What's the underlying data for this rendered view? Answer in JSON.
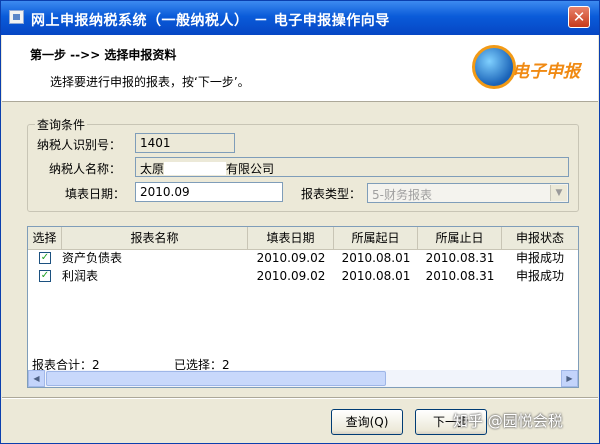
{
  "window": {
    "title": "网上申报纳税系统（一般纳税人） － 电子申报操作向导",
    "close_glyph": "✕"
  },
  "header": {
    "step_title": "第一步 -->> 选择申报资料",
    "step_desc": "选择要进行申报的报表，按‘下一步’。",
    "logo_text": "电子申报"
  },
  "query": {
    "legend": "查询条件",
    "taxpayer_id_label": "纳税人识别号：",
    "taxpayer_id_value": "1401",
    "taxpayer_name_label": "纳税人名称：",
    "taxpayer_name_value_a": "太原",
    "taxpayer_name_value_b": "有限公司",
    "fill_date_label": "填表日期：",
    "fill_date_value": "2010.09",
    "report_type_label": "报表类型：",
    "report_type_value": "5-财务报表"
  },
  "table": {
    "columns": [
      "选择",
      "报表名称",
      "填表日期",
      "所属起日",
      "所属止日",
      "申报状态"
    ],
    "rows": [
      {
        "checked": "✓",
        "name": "资产负债表",
        "fill_date": "2010.09.02",
        "start": "2010.08.01",
        "end": "2010.08.31",
        "status": "申报成功"
      },
      {
        "checked": "✓",
        "name": "利润表",
        "fill_date": "2010.09.02",
        "start": "2010.08.01",
        "end": "2010.08.31",
        "status": "申报成功"
      }
    ],
    "total_label": "报表合计：2",
    "selected_label": "已选择：2"
  },
  "buttons": {
    "query": "查询(Q)",
    "next": "下一步"
  },
  "watermark": "知乎 @园悦会税"
}
